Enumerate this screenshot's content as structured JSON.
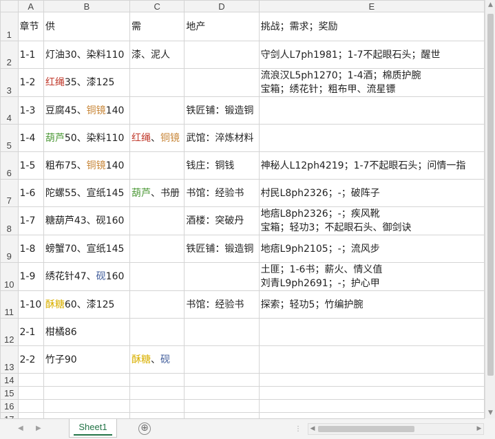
{
  "sheet": {
    "corner_label": "",
    "columns": [
      "A",
      "B",
      "C",
      "D",
      "E"
    ],
    "header_row": {
      "row": "1",
      "cells": [
        {
          "text": "章节"
        },
        {
          "text": "供"
        },
        {
          "text": "需"
        },
        {
          "text": "地产"
        },
        {
          "text": "挑战；需求；奖励"
        }
      ]
    },
    "rows": [
      {
        "row": "2",
        "a": "1-1",
        "b": [
          {
            "t": "灯油30、染料110",
            "c": ""
          }
        ],
        "c": [
          {
            "t": "漆、泥人",
            "c": ""
          }
        ],
        "d": "",
        "e": [
          "守剑人L7ph1981；1-7不起眼石头；醒世"
        ]
      },
      {
        "row": "3",
        "a": "1-2",
        "b": [
          {
            "t": "红绳",
            "c": "#c0392b"
          },
          {
            "t": "35、漆125",
            "c": ""
          }
        ],
        "c": [],
        "d": "",
        "e": [
          "流浪汉L5ph1270；1-4酒；棉质护腕",
          "宝箱；绣花针；粗布甲、流星镖"
        ]
      },
      {
        "row": "4",
        "a": "1-3",
        "b": [
          {
            "t": "豆腐45、",
            "c": ""
          },
          {
            "t": "铜镜",
            "c": "#c8873a"
          },
          {
            "t": "140",
            "c": ""
          }
        ],
        "c": [],
        "d": "铁匠铺：锻造铜",
        "e": []
      },
      {
        "row": "5",
        "a": "1-4",
        "b": [
          {
            "t": "葫芦",
            "c": "#4f9a3a"
          },
          {
            "t": "50、染料110",
            "c": ""
          }
        ],
        "c": [
          {
            "t": "红绳",
            "c": "#c0392b"
          },
          {
            "t": "、",
            "c": ""
          },
          {
            "t": "铜镜",
            "c": "#c8873a"
          }
        ],
        "d": "武馆：淬炼材料",
        "e": []
      },
      {
        "row": "6",
        "a": "1-5",
        "b": [
          {
            "t": "粗布75、",
            "c": ""
          },
          {
            "t": "铜镜",
            "c": "#c8873a"
          },
          {
            "t": "140",
            "c": ""
          }
        ],
        "c": [],
        "d": "钱庄：铜钱",
        "e": [
          "神秘人L12ph4219；1-7不起眼石头；问情一指"
        ]
      },
      {
        "row": "7",
        "a": "1-6",
        "b": [
          {
            "t": "陀螺55、宣纸145",
            "c": ""
          }
        ],
        "c": [
          {
            "t": "葫芦",
            "c": "#4f9a3a"
          },
          {
            "t": "、书册",
            "c": ""
          }
        ],
        "d": "书馆：经验书",
        "e": [
          "村民L8ph2326；-；破阵子"
        ]
      },
      {
        "row": "8",
        "a": "1-7",
        "b": [
          {
            "t": "糖葫芦43、砚160",
            "c": ""
          }
        ],
        "c": [],
        "d": "酒楼：突破丹",
        "e": [
          "地痞L8ph2326；-；疾风靴",
          "宝箱；轻功3；不起眼石头、御剑诀"
        ]
      },
      {
        "row": "9",
        "a": "1-8",
        "b": [
          {
            "t": "螃蟹70、宣纸145",
            "c": ""
          }
        ],
        "c": [],
        "d": "铁匠铺：锻造铜",
        "e": [
          "地痞L9ph2105；-；流风步"
        ]
      },
      {
        "row": "10",
        "a": "1-9",
        "b": [
          {
            "t": "绣花针47、",
            "c": ""
          },
          {
            "t": "砚",
            "c": "#3d5a99"
          },
          {
            "t": "160",
            "c": ""
          }
        ],
        "c": [],
        "d": "",
        "e": [
          "土匪；1-6书；薪火、情义值",
          "刘青L9ph2691；-；护心甲"
        ]
      },
      {
        "row": "11",
        "a": "1-10",
        "b": [
          {
            "t": "酥糖",
            "c": "#d9b000"
          },
          {
            "t": "60、漆125",
            "c": ""
          }
        ],
        "c": [],
        "d": "书馆：经验书",
        "e": [
          "探索；轻功5；竹编护腕"
        ]
      },
      {
        "row": "12",
        "a": "2-1",
        "b": [
          {
            "t": "柑橘86",
            "c": ""
          }
        ],
        "c": [],
        "d": "",
        "e": []
      },
      {
        "row": "13",
        "a": "2-2",
        "b": [
          {
            "t": "竹子90",
            "c": ""
          }
        ],
        "c": [
          {
            "t": "酥糖",
            "c": "#d9b000"
          },
          {
            "t": "、",
            "c": ""
          },
          {
            "t": "砚",
            "c": "#3d5a99"
          }
        ],
        "d": "",
        "e": []
      }
    ],
    "empty_rows": [
      "14",
      "15",
      "16",
      "17"
    ]
  },
  "tabs": {
    "active": "Sheet1",
    "add_symbol": "⊕"
  }
}
